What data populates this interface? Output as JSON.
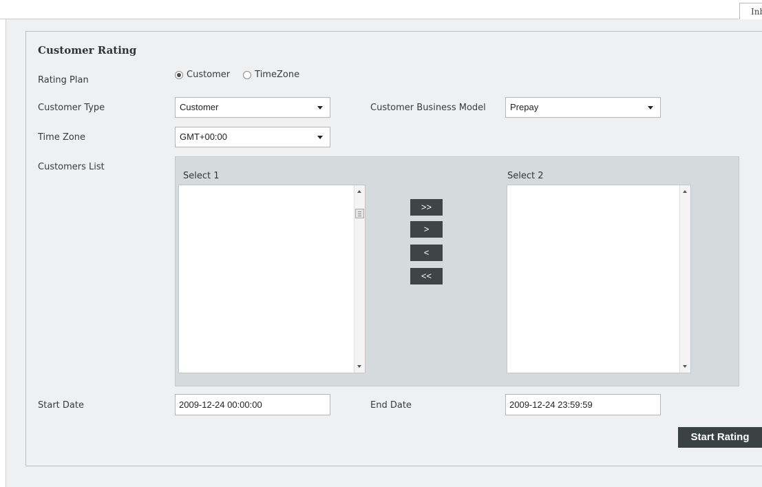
{
  "corner_tab": {
    "label": "Inb"
  },
  "form": {
    "title": "Customer Rating",
    "rating_plan": {
      "label": "Rating Plan",
      "options": [
        "Customer",
        "TimeZone"
      ],
      "selected": "Customer"
    },
    "customer_type": {
      "label": "Customer Type",
      "value": "Customer"
    },
    "business_model": {
      "label": "Customer Business Model",
      "value": "Prepay"
    },
    "time_zone": {
      "label": "Time Zone",
      "value": "GMT+00:00"
    },
    "customers_list": {
      "label": "Customers List",
      "select1_label": "Select 1",
      "select2_label": "Select 2",
      "move_all_right": ">>",
      "move_right": ">",
      "move_left": "<",
      "move_all_left": "<<"
    },
    "start_date": {
      "label": "Start Date",
      "value": "2009-12-24 00:00:00"
    },
    "end_date": {
      "label": "End Date",
      "value": "2009-12-24 23:59:59"
    },
    "submit_label": "Start Rating"
  }
}
